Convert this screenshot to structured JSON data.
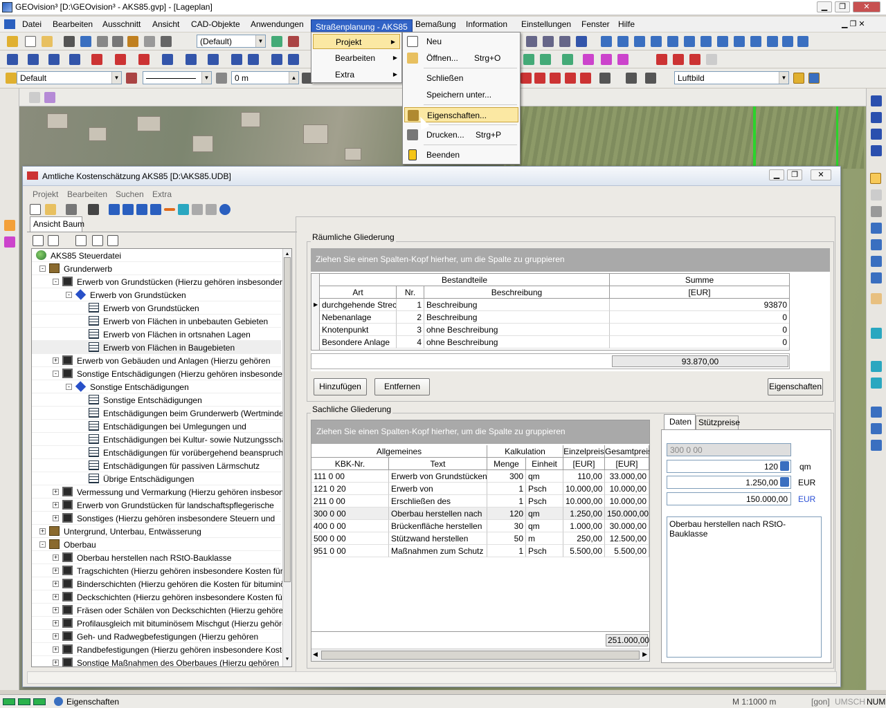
{
  "window": {
    "title": "GEOvision³ [D:\\GEOvision³ - AKS85.gvp] - [Lageplan]"
  },
  "menubar": [
    "Datei",
    "Bearbeiten",
    "Ausschnitt",
    "Ansicht",
    "CAD-Objekte",
    "Anwendungen",
    "Straßenplanung - AKS85",
    "Bemaßung",
    "Information",
    "Einstellungen",
    "Fenster",
    "Hilfe"
  ],
  "toolbar": {
    "layer_combo": "(Default)",
    "style_combo": "Default",
    "offset_combo": "0 m",
    "view_combo": "Luftbild"
  },
  "submenu_aks": [
    "Projekt",
    "Bearbeiten",
    "Extra"
  ],
  "submenu_projekt": {
    "new": "Neu",
    "open": "Öffnen...",
    "open_key": "Strg+O",
    "close": "Schließen",
    "save_as": "Speichern unter...",
    "props": "Eigenschaften...",
    "print": "Drucken...",
    "print_key": "Strg+P",
    "exit": "Beenden"
  },
  "dialog": {
    "title": "Amtliche Kostenschätzung AKS85 [D:\\AKS85.UDB]",
    "menu": [
      "Projekt",
      "Bearbeiten",
      "Suchen",
      "Extra"
    ],
    "tree_tab": "Ansicht Baum",
    "tree": [
      {
        "level": 0,
        "icon": "globe",
        "text": "AKS85 Steuerdatei",
        "exp": ""
      },
      {
        "level": 1,
        "icon": "bld",
        "text": "Grunderwerb",
        "exp": "-"
      },
      {
        "level": 2,
        "icon": "folder",
        "text": "Erwerb von Grundstücken (Hierzu gehören insbesondere",
        "exp": "-"
      },
      {
        "level": 3,
        "icon": "dia",
        "text": "Erwerb von Grundstücken",
        "exp": "-"
      },
      {
        "level": 4,
        "icon": "doc",
        "text": "Erwerb von Grundstücken",
        "exp": ""
      },
      {
        "level": 4,
        "icon": "doc",
        "text": "Erwerb von Flächen in unbebauten Gebieten",
        "exp": ""
      },
      {
        "level": 4,
        "icon": "doc",
        "text": "Erwerb von Flächen in ortsnahen Lagen",
        "exp": ""
      },
      {
        "level": 4,
        "icon": "doc",
        "text": "Erwerb von Flächen in Baugebieten",
        "exp": ""
      },
      {
        "level": 2,
        "icon": "folder",
        "text": "Erwerb von Gebäuden und Anlagen (Hierzu gehören",
        "exp": "+"
      },
      {
        "level": 2,
        "icon": "folder",
        "text": "Sonstige Entschädigungen (Hierzu gehören insbesondere",
        "exp": "-"
      },
      {
        "level": 3,
        "icon": "dia",
        "text": "Sonstige Entschädigungen",
        "exp": "-"
      },
      {
        "level": 4,
        "icon": "doc",
        "text": "Sonstige Entschädigungen",
        "exp": ""
      },
      {
        "level": 4,
        "icon": "doc",
        "text": "Entschädigungen beim Grunderwerb (Wertminderung,",
        "exp": ""
      },
      {
        "level": 4,
        "icon": "doc",
        "text": "Entschädigungen bei Umlegungen und",
        "exp": ""
      },
      {
        "level": 4,
        "icon": "doc",
        "text": "Entschädigungen bei Kultur- sowie Nutzungsschäden",
        "exp": ""
      },
      {
        "level": 4,
        "icon": "doc",
        "text": "Entschädigungen für vorübergehend beanspruchte",
        "exp": ""
      },
      {
        "level": 4,
        "icon": "doc",
        "text": "Entschädigungen für passiven Lärmschutz",
        "exp": ""
      },
      {
        "level": 4,
        "icon": "doc",
        "text": "Übrige Entschädigungen",
        "exp": ""
      },
      {
        "level": 2,
        "icon": "folder",
        "text": "Vermessung und Vermarkung (Hierzu gehören insbesondere",
        "exp": "+"
      },
      {
        "level": 2,
        "icon": "folder",
        "text": "Erwerb von Grundstücken für landschaftspflegerische",
        "exp": "+"
      },
      {
        "level": 2,
        "icon": "folder",
        "text": "Sonstiges (Hierzu gehören insbesondere Steuern und",
        "exp": "+"
      },
      {
        "level": 1,
        "icon": "bld",
        "text": "Untergrund, Unterbau, Entwässerung",
        "exp": "+"
      },
      {
        "level": 1,
        "icon": "bld",
        "text": "Oberbau",
        "exp": "-"
      },
      {
        "level": 2,
        "icon": "folder",
        "text": "Oberbau herstellen nach RStO-Bauklasse",
        "exp": "+"
      },
      {
        "level": 2,
        "icon": "folder",
        "text": "Tragschichten (Hierzu gehören insbesondere Kosten für",
        "exp": "+"
      },
      {
        "level": 2,
        "icon": "folder",
        "text": "Binderschichten (Hierzu gehören die Kosten für bituminöse",
        "exp": "+"
      },
      {
        "level": 2,
        "icon": "folder",
        "text": "Deckschichten (Hierzu gehören insbesondere Kosten für",
        "exp": "+"
      },
      {
        "level": 2,
        "icon": "folder",
        "text": "Fräsen oder Schälen von Deckschichten (Hierzu gehören",
        "exp": "+"
      },
      {
        "level": 2,
        "icon": "folder",
        "text": "Profilausgleich mit bituminösem Mischgut (Hierzu gehören die",
        "exp": "+"
      },
      {
        "level": 2,
        "icon": "folder",
        "text": "Geh- und Radwegbefestigungen (Hierzu gehören",
        "exp": "+"
      },
      {
        "level": 2,
        "icon": "folder",
        "text": "Randbefestigungen (Hierzu gehören insbesondere Kosten für",
        "exp": "+"
      },
      {
        "level": 2,
        "icon": "folder",
        "text": "Sonstige Maßnahmen des Oberbaues (Hierzu gehören",
        "exp": "+"
      }
    ],
    "raeumlich": {
      "title": "Räumliche Gliederung",
      "groupbar": "Ziehen Sie einen Spalten-Kopf hierher, um die Spalte zu gruppieren",
      "band1": "Bestandteile",
      "band2": "Summe",
      "cols": [
        "Art",
        "Nr.",
        "Beschreibung",
        "[EUR]"
      ],
      "rows": [
        [
          "durchgehende Strecke",
          "1",
          "Beschreibung",
          "93870"
        ],
        [
          "Nebenanlage",
          "2",
          " Beschreibung",
          "0"
        ],
        [
          "Knotenpunkt",
          "3",
          "ohne Beschreibung",
          "0"
        ],
        [
          "Besondere Anlage",
          "4",
          "ohne Beschreibung",
          "0"
        ]
      ],
      "total": "93.870,00",
      "btn_add": "Hinzufügen",
      "btn_remove": "Entfernen",
      "btn_props": "Eigenschaften"
    },
    "sachlich": {
      "title": "Sachliche Gliederung",
      "groupbar": "Ziehen Sie einen Spalten-Kopf hierher, um die Spalte zu gruppieren",
      "band1": "Allgemeines",
      "band2": "Kalkulation",
      "band3": "Einzelpreis",
      "band4": "Gesamtpreis",
      "cols": [
        "KBK-Nr.",
        "Text",
        "Menge",
        "Einheit",
        "[EUR]",
        "[EUR]"
      ],
      "rows": [
        [
          "111 0 00",
          "Erwerb von Grundstücken",
          "300",
          "qm",
          "110,00",
          "33.000,00"
        ],
        [
          "121 0 20",
          "Erwerb von",
          "1",
          "Psch",
          "10.000,00",
          "10.000,00"
        ],
        [
          "211 0 00",
          "Erschließen des",
          "1",
          "Psch",
          "10.000,00",
          "10.000,00"
        ],
        [
          "300 0 00",
          "Oberbau herstellen nach",
          "120",
          "qm",
          "1.250,00",
          "150.000,00"
        ],
        [
          "400 0 00",
          "Brückenfläche herstellen",
          "30",
          "qm",
          "1.000,00",
          "30.000,00"
        ],
        [
          "500 0 00",
          "Stützwand herstellen",
          "50",
          "m",
          "250,00",
          "12.500,00"
        ],
        [
          "951 0 00",
          "Maßnahmen zum Schutz",
          "1",
          "Psch",
          "5.500,00",
          "5.500,00"
        ]
      ],
      "total": "251.000,00"
    },
    "details": {
      "tab1": "Daten",
      "tab2": "Stützpreise",
      "code": "300 0 00",
      "menge": "120",
      "menge_unit": "qm",
      "preis": "1.250,00",
      "preis_unit": "EUR",
      "gesamt": "150.000,00",
      "gesamt_unit": "EUR",
      "text": "Oberbau herstellen nach RStO-Bauklasse"
    }
  },
  "status": {
    "text": "Eigenschaften",
    "scale": "M 1:1000  m",
    "unit": "[gon]",
    "umsch": "UMSCH",
    "num": "NUM"
  },
  "colors": {
    "accent": "#3163c6",
    "highlight": "#fbe8a3",
    "groupbar": "#a9a9a9"
  }
}
